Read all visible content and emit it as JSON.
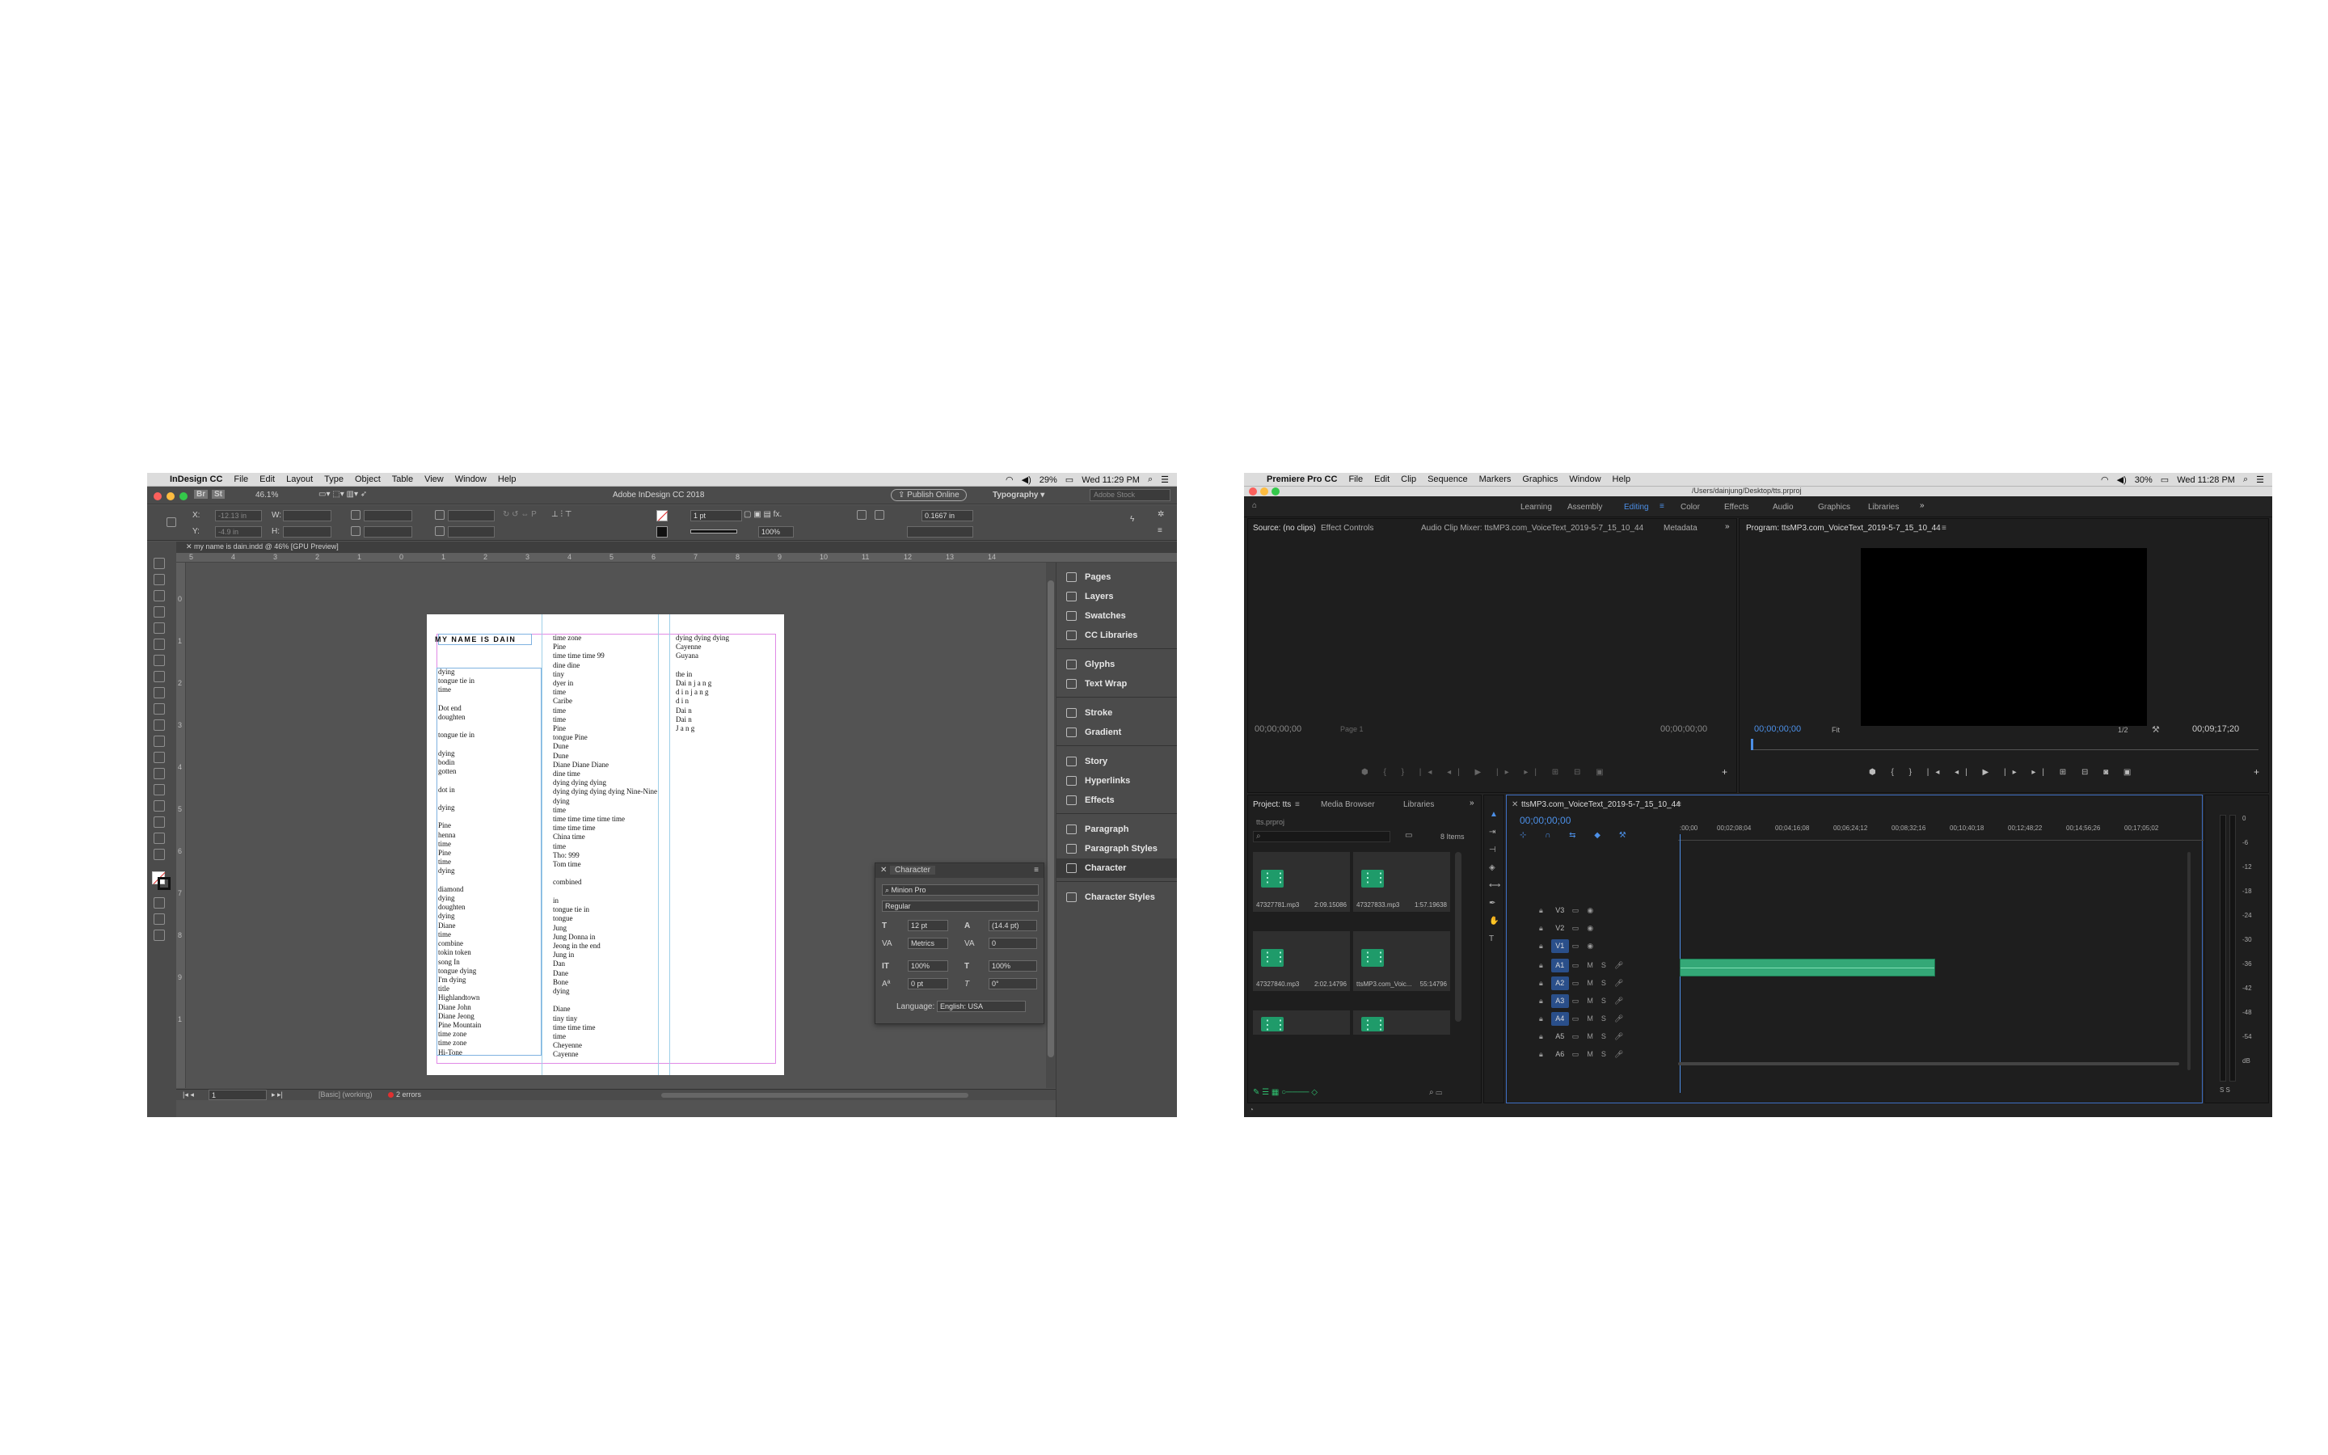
{
  "indesign": {
    "menubar": {
      "app_name": "InDesign CC",
      "items": [
        "File",
        "Edit",
        "Layout",
        "Type",
        "Object",
        "Table",
        "View",
        "Window",
        "Help"
      ],
      "battery": "29%",
      "clock": "Wed 11:29 PM"
    },
    "app_bar": {
      "title": "Adobe InDesign CC 2018",
      "zoom": "46.1%",
      "publish_label": "Publish Online",
      "workspace": "Typography",
      "stock_placeholder": "Adobe Stock"
    },
    "control": {
      "x_label": "X:",
      "x_value": "-12.13 in",
      "y_label": "Y:",
      "y_value": "-4.9 in",
      "w_label": "W:",
      "h_label": "H:",
      "stroke_weight": "1 pt",
      "opacity": "100%",
      "gap": "0.1667 in"
    },
    "doc_tab": "my name is dain.indd @ 46% [GPU Preview]",
    "ruler_top": [
      "5",
      "4",
      "3",
      "2",
      "1",
      "0",
      "1",
      "2",
      "3",
      "4",
      "5",
      "6",
      "7",
      "8",
      "9",
      "10",
      "11",
      "12",
      "13",
      "14"
    ],
    "ruler_left": [
      "0",
      "1",
      "2",
      "3",
      "4",
      "5",
      "6",
      "7",
      "8",
      "9",
      "1"
    ],
    "page": {
      "heading": "MY NAME IS DAIN",
      "col1": "dying\ntongue tie in\ntime\n\nDot end\ndoughten\n\ntongue tie in\n\ndying\nbodin\ngotten\n\ndot in\n\ndying\n\nPine\nhenna\ntime\nPine\ntime\ndying\n\ndiamond\ndying\ndoughten\ndying\nDiane\ntime\ncombine\ntokin token\nsong In\ntongue dying\nI'm dying\ntitle\nHighlandtown\nDiane John\nDiane Jeong\nPine Mountain\ntime zone\ntime zone\nHi-Tone",
      "col2": "time zone\nPine\ntime time time 99\ndine dine\ntiny\ndyer in\ntime\nCaribe\ntime\ntime\nPine\ntongue Pine\nDune\nDune\nDiane Diane Diane\ndine time\ndying dying dying\ndying dying dying dying Nine-Nine\ndying\ntime\ntime time time time time\ntime time time\nChina time\ntime\nTho: 999\nTom time\n\ncombined\n\nin\ntongue tie in\ntongue\nJung\nJung Donna in\nJeong in the end\nJung in\nDan\nDane\nBone\ndying\n\nDiane\ntiny tiny\ntime time time\ntime\nCheyenne\nCayenne",
      "col3": "dying dying dying\nCayenne\nGuyana\n\nthe in\nDai n j a n g\nd i n j a n g\nd i n\nDai n\nDai n\nJ a n g"
    },
    "right_panels": {
      "group1": [
        "Pages",
        "Layers",
        "Swatches",
        "CC Libraries"
      ],
      "group2": [
        "Glyphs",
        "Text Wrap"
      ],
      "group3": [
        "Stroke",
        "Gradient"
      ],
      "group4": [
        "Story",
        "Hyperlinks",
        "Effects"
      ],
      "group5": [
        "Paragraph",
        "Paragraph Styles",
        "Character"
      ],
      "group6": [
        "Character Styles"
      ]
    },
    "character_panel": {
      "title": "Character",
      "font_family": "Minion Pro",
      "font_style": "Regular",
      "size": "12 pt",
      "leading": "(14.4 pt)",
      "kerning": "Metrics",
      "tracking": "0",
      "vscale": "100%",
      "hscale": "100%",
      "baseline": "0 pt",
      "skew": "0°",
      "language_label": "Language:",
      "language": "English: USA"
    },
    "status": {
      "page": "1",
      "preflight_profile": "[Basic] (working)",
      "errors": "2 errors"
    }
  },
  "premiere": {
    "menubar": {
      "app_name": "Premiere Pro CC",
      "items": [
        "File",
        "Edit",
        "Clip",
        "Sequence",
        "Markers",
        "Graphics",
        "Window",
        "Help"
      ],
      "battery": "30%",
      "clock": "Wed 11:28 PM"
    },
    "title_path": "/Users/dainjung/Desktop/tts.prproj",
    "workspaces": [
      "Learning",
      "Assembly",
      "Editing",
      "Color",
      "Effects",
      "Audio",
      "Graphics",
      "Libraries"
    ],
    "active_workspace": "Editing",
    "source_tabs": [
      "Source: (no clips)",
      "Effect Controls",
      "Audio Clip Mixer: ttsMP3.com_VoiceText_2019-5-7_15_10_44",
      "Metadata"
    ],
    "source": {
      "tc_left": "00;00;00;00",
      "page_label": "Page 1",
      "tc_right": "00;00;00;00"
    },
    "program": {
      "title": "Program: ttsMP3.com_VoiceText_2019-5-7_15_10_44",
      "timecode": "00;00;00;00",
      "fit": "Fit",
      "ratio": "1/2",
      "duration": "00;09;17;20"
    },
    "project": {
      "tabs": [
        "Project: tts",
        "Media Browser",
        "Libraries"
      ],
      "file": "tts.prproj",
      "items_count": "8 Items",
      "clips": [
        {
          "name": "47327781.mp3",
          "duration": "2:09.15086"
        },
        {
          "name": "47327833.mp3",
          "duration": "1:57.19638"
        },
        {
          "name": "47327840.mp3",
          "duration": "2:02.14796"
        },
        {
          "name": "ttsMP3.com_Voic...",
          "duration": "55:14796"
        },
        {
          "name": "",
          "": ""
        },
        {
          "name": "",
          "": ""
        }
      ]
    },
    "timeline": {
      "tab": "ttsMP3.com_VoiceText_2019-5-7_15_10_44",
      "timecode": "00;00;00;00",
      "ruler": [
        ":00;00",
        "00;02;08;04",
        "00;04;16;08",
        "00;06;24;12",
        "00;08;32;16",
        "00;10;40;18",
        "00;12;48;22",
        "00;14;56;26",
        "00;17;05;02"
      ],
      "video_tracks": [
        "V3",
        "V2",
        "V1"
      ],
      "audio_tracks": [
        "A1",
        "A2",
        "A3",
        "A4",
        "A5",
        "A6"
      ],
      "mute_label": "M",
      "solo_label": "S"
    },
    "meter_ticks": [
      "0",
      "-6",
      "-12",
      "-18",
      "-24",
      "-30",
      "-36",
      "-42",
      "-48",
      "-54",
      "dB"
    ],
    "meter_solo": "S S"
  }
}
